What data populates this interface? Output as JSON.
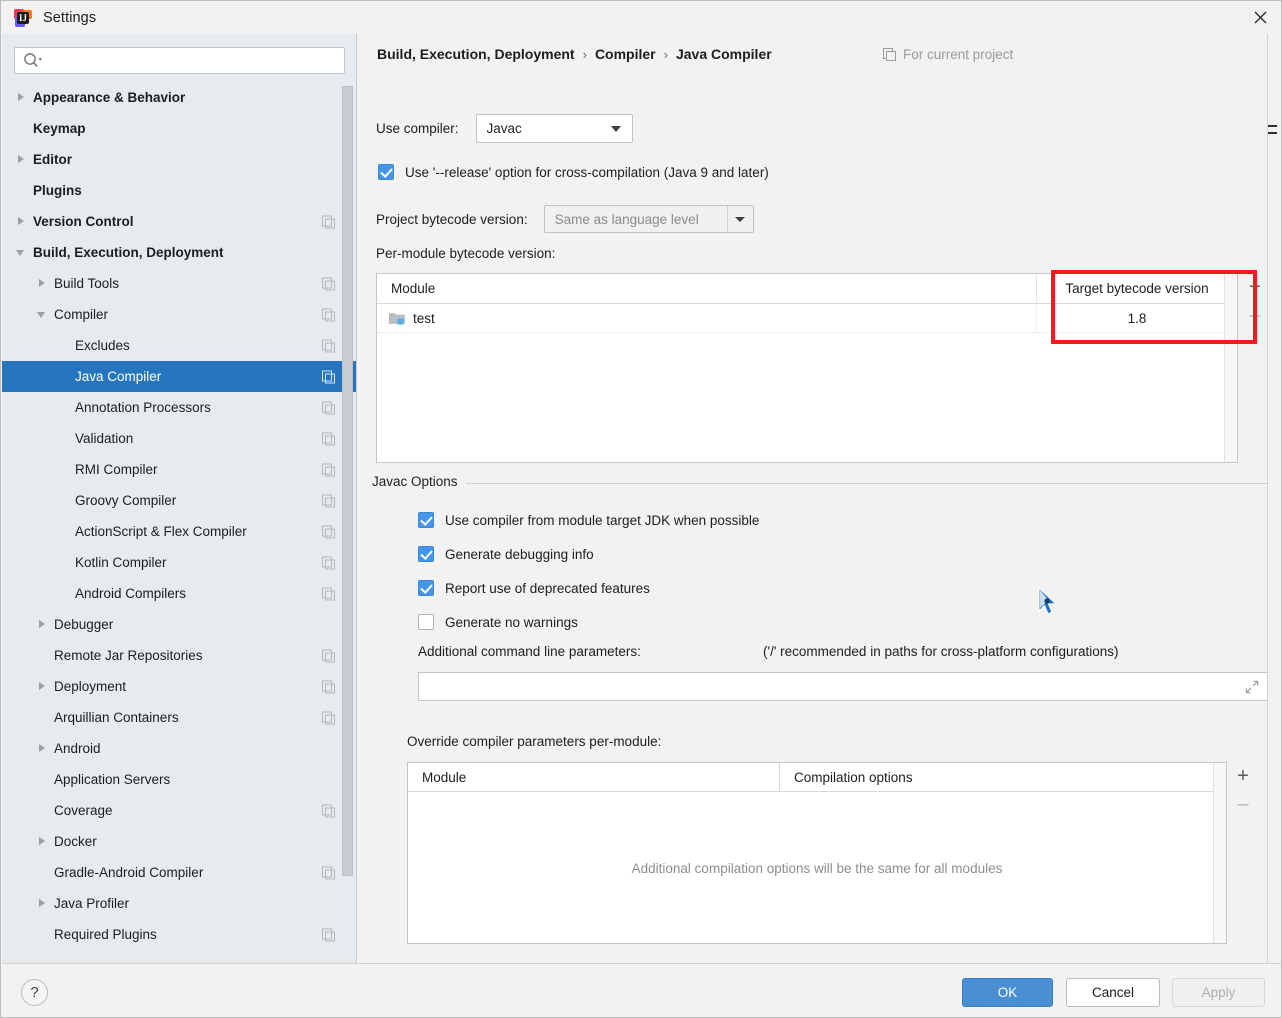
{
  "window": {
    "title": "Settings",
    "logo_icon": "intellij-idea-logo",
    "close_icon": "close-icon"
  },
  "sidebar": {
    "search": {
      "placeholder": "",
      "value": "",
      "icon": "search-icon"
    },
    "items": [
      {
        "label": "Appearance & Behavior",
        "indent": 0,
        "arrow": "closed",
        "bold": true,
        "copy": false,
        "selected": false
      },
      {
        "label": "Keymap",
        "indent": 0,
        "arrow": "none",
        "bold": true,
        "copy": false,
        "selected": false
      },
      {
        "label": "Editor",
        "indent": 0,
        "arrow": "closed",
        "bold": true,
        "copy": false,
        "selected": false
      },
      {
        "label": "Plugins",
        "indent": 0,
        "arrow": "none",
        "bold": true,
        "copy": false,
        "selected": false
      },
      {
        "label": "Version Control",
        "indent": 0,
        "arrow": "closed",
        "bold": true,
        "copy": true,
        "selected": false
      },
      {
        "label": "Build, Execution, Deployment",
        "indent": 0,
        "arrow": "open",
        "bold": true,
        "copy": false,
        "selected": false
      },
      {
        "label": "Build Tools",
        "indent": 1,
        "arrow": "closed",
        "bold": false,
        "copy": true,
        "selected": false
      },
      {
        "label": "Compiler",
        "indent": 1,
        "arrow": "open",
        "bold": false,
        "copy": true,
        "selected": false
      },
      {
        "label": "Excludes",
        "indent": 2,
        "arrow": "none",
        "bold": false,
        "copy": true,
        "selected": false
      },
      {
        "label": "Java Compiler",
        "indent": 2,
        "arrow": "none",
        "bold": false,
        "copy": true,
        "selected": true
      },
      {
        "label": "Annotation Processors",
        "indent": 2,
        "arrow": "none",
        "bold": false,
        "copy": true,
        "selected": false
      },
      {
        "label": "Validation",
        "indent": 2,
        "arrow": "none",
        "bold": false,
        "copy": true,
        "selected": false
      },
      {
        "label": "RMI Compiler",
        "indent": 2,
        "arrow": "none",
        "bold": false,
        "copy": true,
        "selected": false
      },
      {
        "label": "Groovy Compiler",
        "indent": 2,
        "arrow": "none",
        "bold": false,
        "copy": true,
        "selected": false
      },
      {
        "label": "ActionScript & Flex Compiler",
        "indent": 2,
        "arrow": "none",
        "bold": false,
        "copy": true,
        "selected": false
      },
      {
        "label": "Kotlin Compiler",
        "indent": 2,
        "arrow": "none",
        "bold": false,
        "copy": true,
        "selected": false
      },
      {
        "label": "Android Compilers",
        "indent": 2,
        "arrow": "none",
        "bold": false,
        "copy": true,
        "selected": false
      },
      {
        "label": "Debugger",
        "indent": 1,
        "arrow": "closed",
        "bold": false,
        "copy": false,
        "selected": false
      },
      {
        "label": "Remote Jar Repositories",
        "indent": 1,
        "arrow": "none",
        "bold": false,
        "copy": true,
        "selected": false
      },
      {
        "label": "Deployment",
        "indent": 1,
        "arrow": "closed",
        "bold": false,
        "copy": true,
        "selected": false
      },
      {
        "label": "Arquillian Containers",
        "indent": 1,
        "arrow": "none",
        "bold": false,
        "copy": true,
        "selected": false
      },
      {
        "label": "Android",
        "indent": 1,
        "arrow": "closed",
        "bold": false,
        "copy": false,
        "selected": false
      },
      {
        "label": "Application Servers",
        "indent": 1,
        "arrow": "none",
        "bold": false,
        "copy": false,
        "selected": false
      },
      {
        "label": "Coverage",
        "indent": 1,
        "arrow": "none",
        "bold": false,
        "copy": true,
        "selected": false
      },
      {
        "label": "Docker",
        "indent": 1,
        "arrow": "closed",
        "bold": false,
        "copy": false,
        "selected": false
      },
      {
        "label": "Gradle-Android Compiler",
        "indent": 1,
        "arrow": "none",
        "bold": false,
        "copy": true,
        "selected": false
      },
      {
        "label": "Java Profiler",
        "indent": 1,
        "arrow": "closed",
        "bold": false,
        "copy": false,
        "selected": false
      },
      {
        "label": "Required Plugins",
        "indent": 1,
        "arrow": "none",
        "bold": false,
        "copy": true,
        "selected": false
      }
    ]
  },
  "main": {
    "breadcrumb": {
      "parts": [
        "Build, Execution, Deployment",
        "Compiler",
        "Java Compiler"
      ],
      "separator": "›"
    },
    "scope_note": {
      "label": "For current project",
      "icon": "copy-scope-icon"
    },
    "use_compiler": {
      "label": "Use compiler:",
      "value": "Javac"
    },
    "release_option": {
      "label": "Use '--release' option for cross-compilation (Java 9 and later)",
      "checked": true
    },
    "project_bytecode": {
      "label": "Project bytecode version:",
      "value": "Same as language level"
    },
    "per_module": {
      "label": "Per-module bytecode version:",
      "columns": [
        "Module",
        "Target bytecode version"
      ],
      "rows": [
        {
          "module": "test",
          "target": "1.8",
          "icon": "module-folder-icon"
        }
      ],
      "add_label": "+",
      "remove_label": "–"
    },
    "javac_options": {
      "legend": "Javac Options",
      "checkboxes": [
        {
          "label": "Use compiler from module target JDK when possible",
          "checked": true
        },
        {
          "label": "Generate debugging info",
          "checked": true
        },
        {
          "label": "Report use of deprecated features",
          "checked": true
        },
        {
          "label": "Generate no warnings",
          "checked": false
        }
      ],
      "additional_params": {
        "label": "Additional command line parameters:",
        "hint": "('/' recommended in paths for cross-platform configurations)",
        "value": "",
        "expand_icon": "expand-icon"
      },
      "override": {
        "label": "Override compiler parameters per-module:",
        "columns": [
          "Module",
          "Compilation options"
        ],
        "empty_text": "Additional compilation options will be the same for all modules",
        "add_label": "+",
        "remove_label": "–"
      }
    }
  },
  "footer": {
    "help_label": "?",
    "ok_label": "OK",
    "cancel_label": "Cancel",
    "apply_label": "Apply"
  },
  "colors": {
    "accent": "#2675bf",
    "ok_button": "#4a8fd4",
    "checkbox": "#4596e8",
    "highlight_rect": "#ee1c1c",
    "sidebar_bg": "#e6ebef",
    "panel_bg": "#f2f2f2"
  }
}
